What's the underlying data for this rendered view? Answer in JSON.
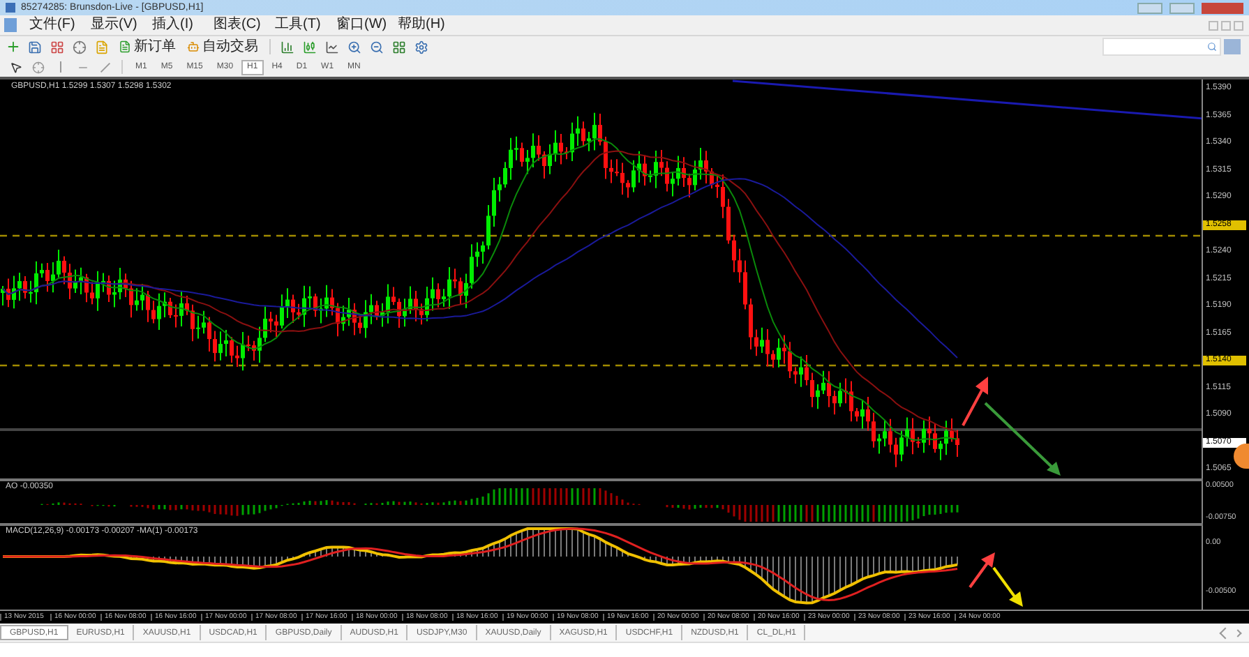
{
  "window": {
    "title": "85274285: Brunsdon-Live - [GBPUSD,H1]"
  },
  "menu": [
    {
      "label": "文件(F)"
    },
    {
      "label": "显示(V)"
    },
    {
      "label": "插入(I)"
    },
    {
      "label": "图表(C)"
    },
    {
      "label": "工具(T)"
    },
    {
      "label": "窗口(W)"
    },
    {
      "label": "帮助(H)"
    }
  ],
  "toolbar": {
    "new_order": "新订单",
    "autotrading": "自动交易"
  },
  "timeframes": [
    {
      "label": "M1",
      "selected": false
    },
    {
      "label": "M5",
      "selected": false
    },
    {
      "label": "M15",
      "selected": false
    },
    {
      "label": "M30",
      "selected": false
    },
    {
      "label": "H1",
      "selected": true
    },
    {
      "label": "H4",
      "selected": false
    },
    {
      "label": "D1",
      "selected": false
    },
    {
      "label": "W1",
      "selected": false
    },
    {
      "label": "MN",
      "selected": false
    }
  ],
  "chart": {
    "header": "GBPUSD,H1 1.5299 1.5307 1.5298 1.5302",
    "price_labels": [
      {
        "text": "1.5390",
        "kind": "plain"
      },
      {
        "text": "1.5365",
        "kind": "plain"
      },
      {
        "text": "1.5340",
        "kind": "plain"
      },
      {
        "text": "1.5315",
        "kind": "plain"
      },
      {
        "text": "1.5290",
        "kind": "plain"
      },
      {
        "text": "1.5258",
        "kind": "level"
      },
      {
        "text": "1.5240",
        "kind": "plain"
      },
      {
        "text": "1.5215",
        "kind": "plain"
      },
      {
        "text": "1.5190",
        "kind": "plain"
      },
      {
        "text": "1.5165",
        "kind": "plain"
      },
      {
        "text": "1.5140",
        "kind": "level"
      },
      {
        "text": "1.5115",
        "kind": "plain"
      },
      {
        "text": "1.5090",
        "kind": "plain"
      },
      {
        "text": "1.5070",
        "kind": "current"
      },
      {
        "text": "1.5065",
        "kind": "plain"
      }
    ],
    "ao": {
      "label": "AO -0.00350",
      "scale": [
        "0.00500",
        "-0.00750"
      ]
    },
    "macd": {
      "label": "MACD(12,26,9) -0.00173 -0.00207 -MA(1) -0.00173",
      "scale": [
        "0.00",
        "-0.00500"
      ]
    },
    "time_labels": [
      "13 Nov 2015",
      "16 Nov 00:00",
      "16 Nov 08:00",
      "16 Nov 16:00",
      "17 Nov 00:00",
      "17 Nov 08:00",
      "17 Nov 16:00",
      "18 Nov 00:00",
      "18 Nov 08:00",
      "18 Nov 16:00",
      "19 Nov 00:00",
      "19 Nov 08:00",
      "19 Nov 16:00",
      "20 Nov 00:00",
      "20 Nov 08:00",
      "20 Nov 16:00",
      "23 Nov 00:00",
      "23 Nov 08:00",
      "23 Nov 16:00",
      "24 Nov 00:00"
    ]
  },
  "tabs": [
    {
      "label": "GBPUSD,H1",
      "selected": true
    },
    {
      "label": "EURUSD,H1",
      "selected": false
    },
    {
      "label": "XAUUSD,H1",
      "selected": false
    },
    {
      "label": "USDCAD,H1",
      "selected": false
    },
    {
      "label": "GBPUSD,Daily",
      "selected": false
    },
    {
      "label": "AUDUSD,H1",
      "selected": false
    },
    {
      "label": "USDJPY,M30",
      "selected": false
    },
    {
      "label": "XAUUSD,Daily",
      "selected": false
    },
    {
      "label": "XAGUSD,H1",
      "selected": false
    },
    {
      "label": "USDCHF,H1",
      "selected": false
    },
    {
      "label": "NZDUSD,H1",
      "selected": false
    },
    {
      "label": "CL_DL,H1",
      "selected": false
    }
  ]
}
